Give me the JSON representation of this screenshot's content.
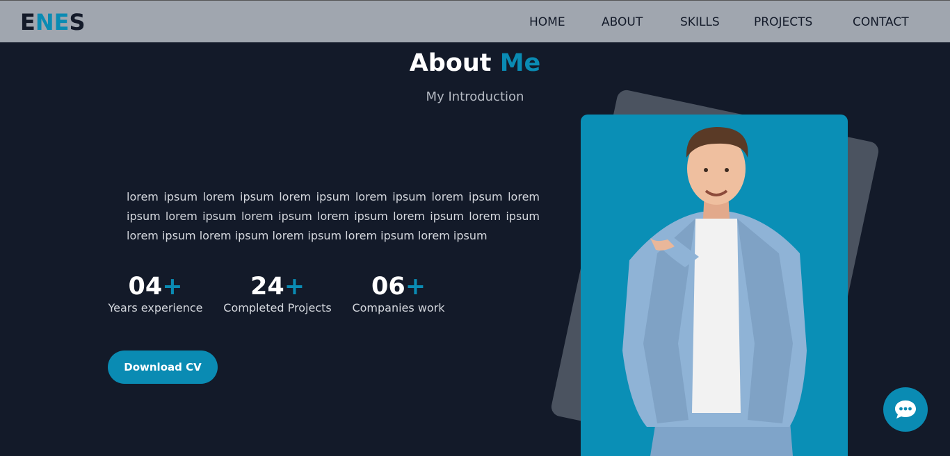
{
  "logo": {
    "part1": "E",
    "part2": "NE",
    "part3": "S"
  },
  "nav": {
    "items": [
      {
        "label": "HOME"
      },
      {
        "label": "ABOUT"
      },
      {
        "label": "SKILLS"
      },
      {
        "label": "PROJECTS"
      },
      {
        "label": "CONTACT"
      }
    ]
  },
  "about": {
    "title_main": "About",
    "title_accent": "Me",
    "subtitle": "My Introduction",
    "intro": "lorem ipsum lorem ipsum lorem ipsum lorem ipsum lorem ipsum lorem ipsum lorem ipsum lorem ipsum lorem ipsum lorem ipsum lorem ipsum lorem ipsum lorem ipsum lorem ipsum lorem ipsum lorem ipsum",
    "stats": [
      {
        "number": "04",
        "plus": "+",
        "label": "Years experience"
      },
      {
        "number": "24",
        "plus": "+",
        "label": "Completed Projects"
      },
      {
        "number": "06",
        "plus": "+",
        "label": "Companies work"
      }
    ],
    "cv_button": "Download CV"
  },
  "colors": {
    "accent": "#0a8bb3",
    "background": "#131a29",
    "navbar": "#a0a6af"
  },
  "icons": {
    "chat": "chat-bubble-icon"
  }
}
